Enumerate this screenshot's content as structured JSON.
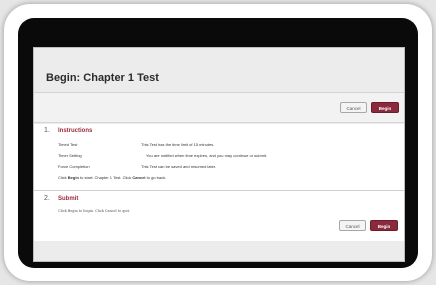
{
  "page": {
    "title": "Begin: Chapter 1 Test"
  },
  "top_actions": {
    "cancel_label": "Cancel",
    "begin_label": "Begin"
  },
  "instructions": {
    "number": "1.",
    "title": "Instructions",
    "rows": [
      {
        "label": "Timed Test",
        "value": "This Test has the time limit of 15 minutes."
      },
      {
        "label": "Timer Setting",
        "value": "You are notified when time expires, and you may continue or submit."
      },
      {
        "label": "Force Completion",
        "value": "This Test can be saved and resumed later."
      }
    ],
    "footer": {
      "part1": "Click ",
      "begin_word": "Begin",
      "part2": " to start: Chapter 1 Test. Click ",
      "cancel_word": "Cancel",
      "part3": " to go back."
    }
  },
  "submit": {
    "number": "2.",
    "title": "Submit",
    "note": "Click Begin to begin. Click Cancel to quit.",
    "cancel_label": "Cancel",
    "begin_label": "Begin"
  },
  "colors": {
    "accent": "#9b2a3c",
    "begin_button": "#8a2a3c",
    "frame": "#ffffff",
    "screen": "#0a0a0a"
  }
}
